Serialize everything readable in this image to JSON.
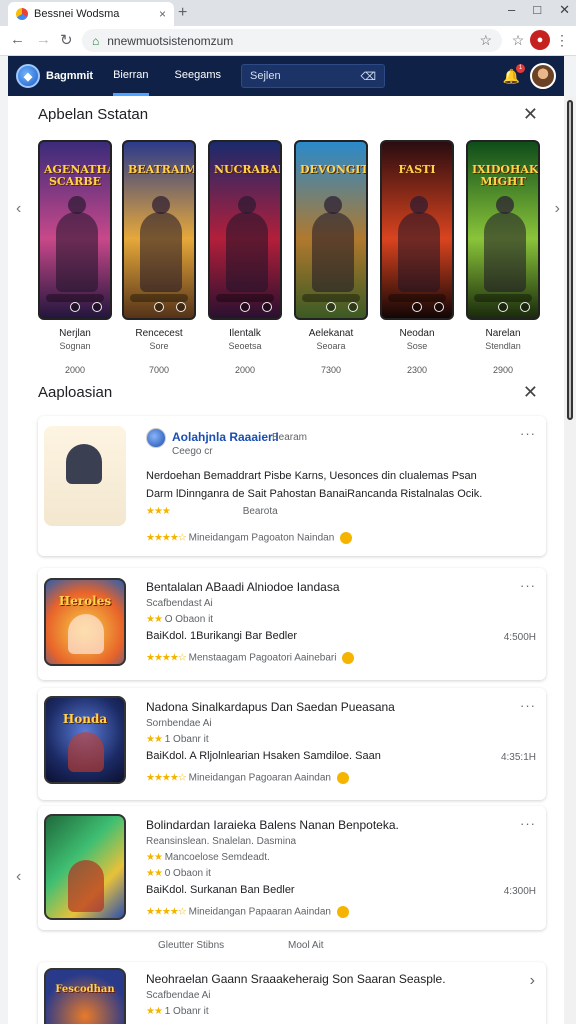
{
  "tab": {
    "title": "Bessnei Wodsma",
    "close": "×",
    "new": "+"
  },
  "window": {
    "minimize": "–",
    "maximize": "□",
    "close": "✕"
  },
  "toolbar": {
    "back": "←",
    "forward": "→",
    "reload": "↻",
    "home": "⌂",
    "url": "nnewmuotsistenomzum",
    "star": "☆"
  },
  "header": {
    "brand": "Bagmmit",
    "nav": [
      "Bierran",
      "Seegams"
    ],
    "search_placeholder": "Sejlen",
    "search_icon": "⌫"
  },
  "section1": {
    "title": "Apbelan Sstatan",
    "close": "✕"
  },
  "featured": [
    {
      "title": "AGENATHA SCARBE",
      "name": "Nerjlan",
      "sub": "Sognan",
      "count": "2000",
      "colors": [
        "#3a2b7a",
        "#c8488a",
        "#22163d"
      ]
    },
    {
      "title": "BEATRAIMIN",
      "name": "Rencecest",
      "sub": "Sore",
      "count": "7000",
      "colors": [
        "#2b3a8a",
        "#e6a83a",
        "#553319"
      ]
    },
    {
      "title": "NUCRABAN",
      "name": "Ilentalk",
      "sub": "Seoetsa",
      "count": "2000",
      "colors": [
        "#1a2a6c",
        "#b21f3a",
        "#2a1030"
      ]
    },
    {
      "title": "DEVONGITNIR",
      "name": "Aelekanat",
      "sub": "Seoara",
      "count": "7300",
      "colors": [
        "#2a8acb",
        "#b0792e",
        "#3b5a24"
      ]
    },
    {
      "title": "FASTI",
      "name": "Neodan",
      "sub": "Sose",
      "count": "2300",
      "colors": [
        "#2a0c10",
        "#d9441f",
        "#120606"
      ]
    },
    {
      "title": "IXIDOHAK MIGHT",
      "name": "Narelan",
      "sub": "Stendlan",
      "count": "2900",
      "colors": [
        "#0f4d1a",
        "#8ac43a",
        "#1a2a0c"
      ]
    }
  ],
  "section2": {
    "title": "Aaploasian",
    "close": "✕"
  },
  "list": [
    {
      "title": "Aolahjnla Raaaier.I",
      "subtitle": "Ceego cr",
      "meta": "Bearam",
      "desc1": "Nerdoehan Bemaddrart Pisbe Karns, Uesonces din clualemas Psan",
      "desc2": "Darm lDinnganra de Sait Pahostan BanaiRancanda Ristalnalas Ocik.",
      "star_label": "Bearota",
      "rating_text": "Mineidangam Pagoaton Naindan",
      "more": "···"
    },
    {
      "title": "Bentalalan ABaadi Alniodoe Iandasa",
      "subtitle": "Scafbendast Ai",
      "meta": "O Obaon it",
      "desc1": "BaiKdol. 1Burikangi Bar Bedler",
      "price": "4:500H",
      "rating_text": "Menstaagam Pagoatori Aainebari",
      "more": "···",
      "thumb_title": "Heroles"
    },
    {
      "title": "Nadona Sinalkardapus Dan Saedan Pueasana",
      "subtitle": "Sornbendae Ai",
      "meta": "1 Obanr it",
      "desc1": "BaiKdol. A Rljolnlearian Hsaken Samdiloe. Saan",
      "price": "4:35:1H",
      "rating_text": "Mineidangan Pagoaran Aaindan",
      "more": "···",
      "thumb_title": "Honda"
    },
    {
      "title": "Bolindardan Iaraieka Balens Nanan Benpoteka.",
      "subtitle": "Reansinslean. Snalelan. Dasmina",
      "meta": "Mancoelose Semdeadt.",
      "meta2": "0 Obaon it",
      "desc1": "BaiKdol. Surkanan Ban Bedler",
      "price": "4:300H",
      "rating_text": "Mineidangan Papaaran Aaindan",
      "more": "···"
    },
    {
      "title": "Neohraelan Gaann Sraaakeheraig Son Saaran Seasple.",
      "subtitle": "Scafbendae Ai",
      "meta": "1 Obanr it",
      "chevron": "›",
      "thumb_title": "Fescodhan"
    }
  ],
  "footer": {
    "left": "Gleutter Stibns",
    "right": "Mool Ait"
  },
  "arrows": {
    "left": "‹",
    "right": "›"
  }
}
